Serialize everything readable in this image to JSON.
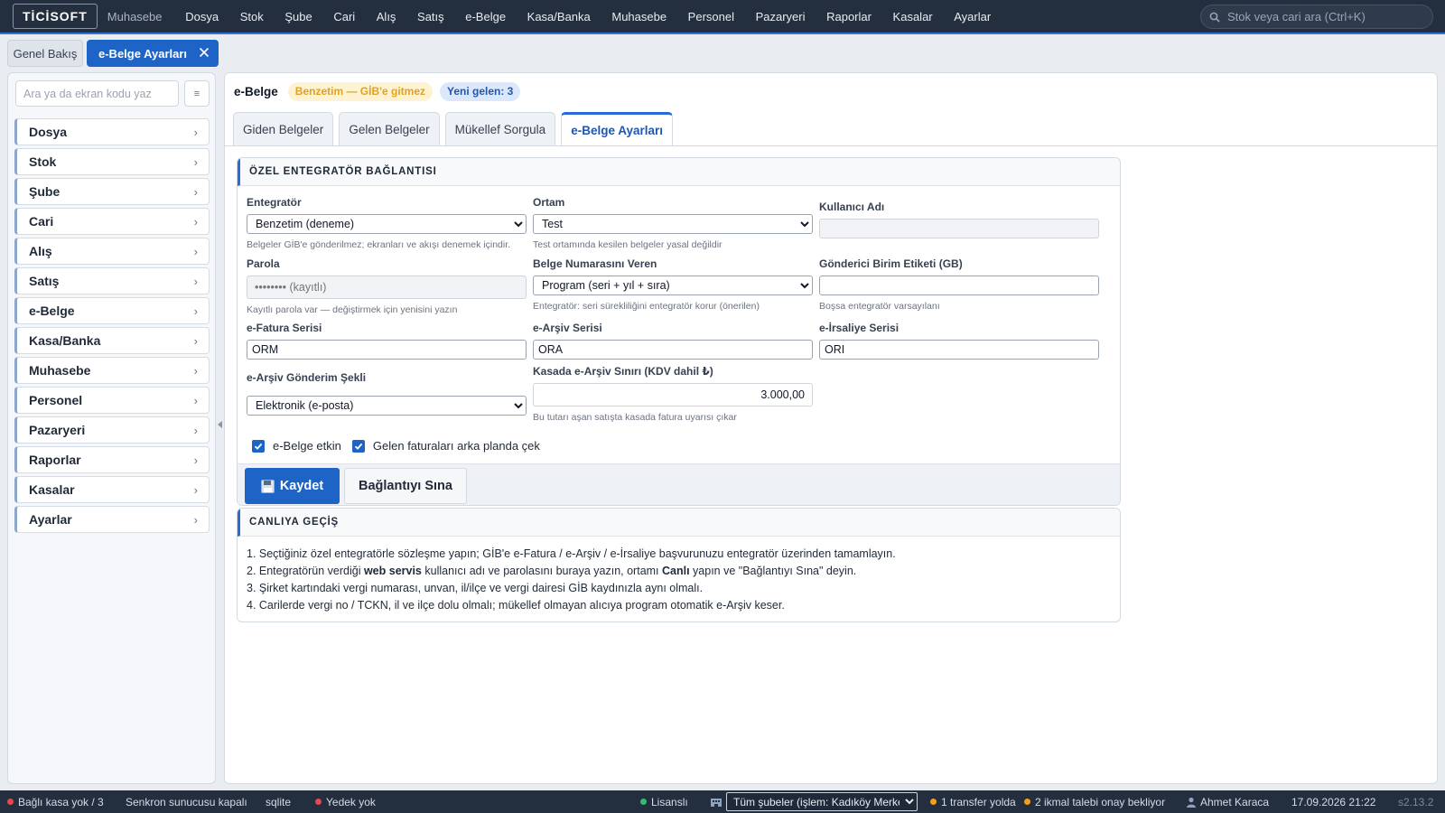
{
  "app": {
    "brand": "TİCİSOFT",
    "brand_sub": "Muhasebe"
  },
  "topnav": [
    "Dosya",
    "Stok",
    "Şube",
    "Cari",
    "Alış",
    "Satış",
    "e-Belge",
    "Kasa/Banka",
    "Muhasebe",
    "Personel",
    "Pazaryeri",
    "Raporlar",
    "Kasalar",
    "Ayarlar"
  ],
  "search": {
    "placeholder": "Stok veya cari ara (Ctrl+K)",
    "icon": "search-icon"
  },
  "tabs": {
    "overview": "Genel Bakış",
    "active": "e-Belge Ayarları"
  },
  "sidebar": {
    "search_placeholder": "Ara ya da ekran kodu yaz",
    "button_glyph": "≡",
    "items": [
      "Dosya",
      "Stok",
      "Şube",
      "Cari",
      "Alış",
      "Satış",
      "e-Belge",
      "Kasa/Banka",
      "Muhasebe",
      "Personel",
      "Pazaryeri",
      "Raporlar",
      "Kasalar",
      "Ayarlar"
    ],
    "chevron": "›"
  },
  "header": {
    "title": "e-Belge",
    "badge_sim": "Benzetim — GİB'e gitmez",
    "badge_new": "Yeni gelen: 3"
  },
  "subtabs": [
    "Giden Belgeler",
    "Gelen Belgeler",
    "Mükellef Sorgula",
    "e-Belge Ayarları"
  ],
  "connection": {
    "title": "ÖZEL ENTEGRATÖR BAĞLANTISI",
    "integrator": {
      "label": "Entegratör",
      "value": "Benzetim (deneme)",
      "hint": "Belgeler GİB'e gönderilmez; ekranları ve akışı denemek içindir."
    },
    "env": {
      "label": "Ortam",
      "value": "Test",
      "hint": "Test ortamında kesilen belgeler yasal değildir"
    },
    "username": {
      "label": "Kullanıcı Adı",
      "value": ""
    },
    "password": {
      "label": "Parola",
      "placeholder": "•••••••• (kayıtlı)",
      "hint": "Kayıtlı parola var — değiştirmek için yenisini yazın"
    },
    "numbering": {
      "label": "Belge Numarasını Veren",
      "value": "Program (seri + yıl + sıra)",
      "hint": "Entegratör: seri sürekliliğini entegratör korur (önerilen)"
    },
    "sender_tag": {
      "label": "Gönderici Birim Etiketi (GB)",
      "value": "",
      "hint": "Boşsa entegratör varsayılanı"
    },
    "efatura_series": {
      "label": "e-Fatura Serisi",
      "value": "ORM"
    },
    "earsiv_series": {
      "label": "e-Arşiv Serisi",
      "value": "ORA"
    },
    "eirsaliye_series": {
      "label": "e-İrsaliye Serisi",
      "value": "ORI"
    },
    "earsiv_send": {
      "label": "e-Arşiv Gönderim Şekli",
      "value": "Elektronik (e-posta)"
    },
    "cash_limit": {
      "label": "Kasada e-Arşiv Sınırı (KDV dahil ₺)",
      "value": "3.000,00",
      "hint": "Bu tutarı aşan satışta kasada fatura uyarısı çıkar"
    },
    "check_enabled": "e-Belge etkin",
    "check_fetch": "Gelen faturaları arka planda çek",
    "save": "Kaydet",
    "test": "Bağlantıyı Sına"
  },
  "golive": {
    "title": "CANLIYA GEÇİŞ",
    "step1": "1. Seçtiğiniz özel entegratörle sözleşme yapın; GİB'e e-Fatura / e-Arşiv / e-İrsaliye başvurunuzu entegratör üzerinden tamamlayın.",
    "step2_a": "2. Entegratörün verdiği ",
    "step2_b": "web servis",
    "step2_c": " kullanıcı adı ve parolasını buraya yazın, ortamı ",
    "step2_d": "Canlı",
    "step2_e": " yapın ve \"Bağlantıyı Sına\" deyin.",
    "step3": "3. Şirket kartındaki vergi numarası, unvan, il/ilçe ve vergi dairesi GİB kaydınızla aynı olmalı.",
    "step4": "4. Carilerde vergi no / TCKN, il ve ilçe dolu olmalı; mükellef olmayan alıcıya program otomatik e-Arşiv keser."
  },
  "status": {
    "kasa": "Bağlı kasa yok / 3",
    "sync": "Senkron sunucusu kapalı",
    "db": "sqlite",
    "backup": "Yedek yok",
    "license": "Lisanslı",
    "branch": "Tüm şubeler (işlem: Kadıköy Merkez)",
    "transfer": "1 transfer yolda",
    "requests": "2 ikmal talebi onay bekliyor",
    "user": "Ahmet Karaca",
    "datetime": "17.09.2026 21:22",
    "version": "s2.13.2",
    "colors": {
      "red": "#e5484d",
      "green": "#2fbf71",
      "orange": "#f0a020"
    }
  }
}
